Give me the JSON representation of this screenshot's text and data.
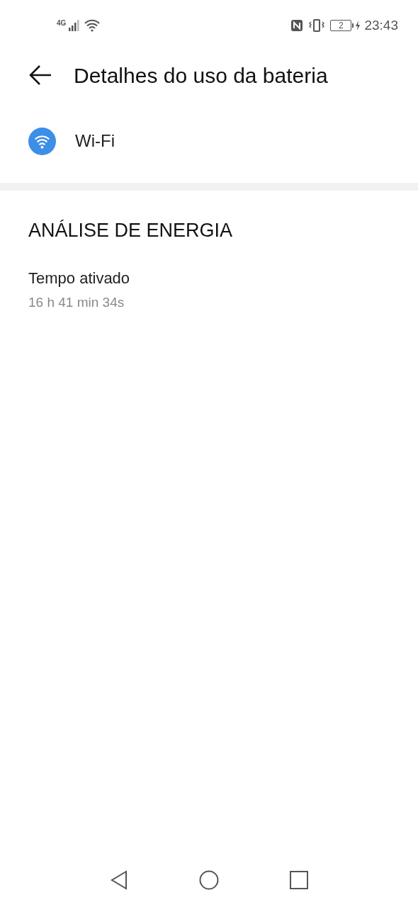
{
  "status_bar": {
    "network": "4G",
    "battery": "2",
    "time": "23:43"
  },
  "header": {
    "title": "Detalhes do uso da bateria"
  },
  "app": {
    "name": "Wi-Fi"
  },
  "section": {
    "title": "ANÁLISE DE ENERGIA",
    "items": [
      {
        "label": "Tempo ativado",
        "value": "16 h 41 min 34s"
      }
    ]
  }
}
